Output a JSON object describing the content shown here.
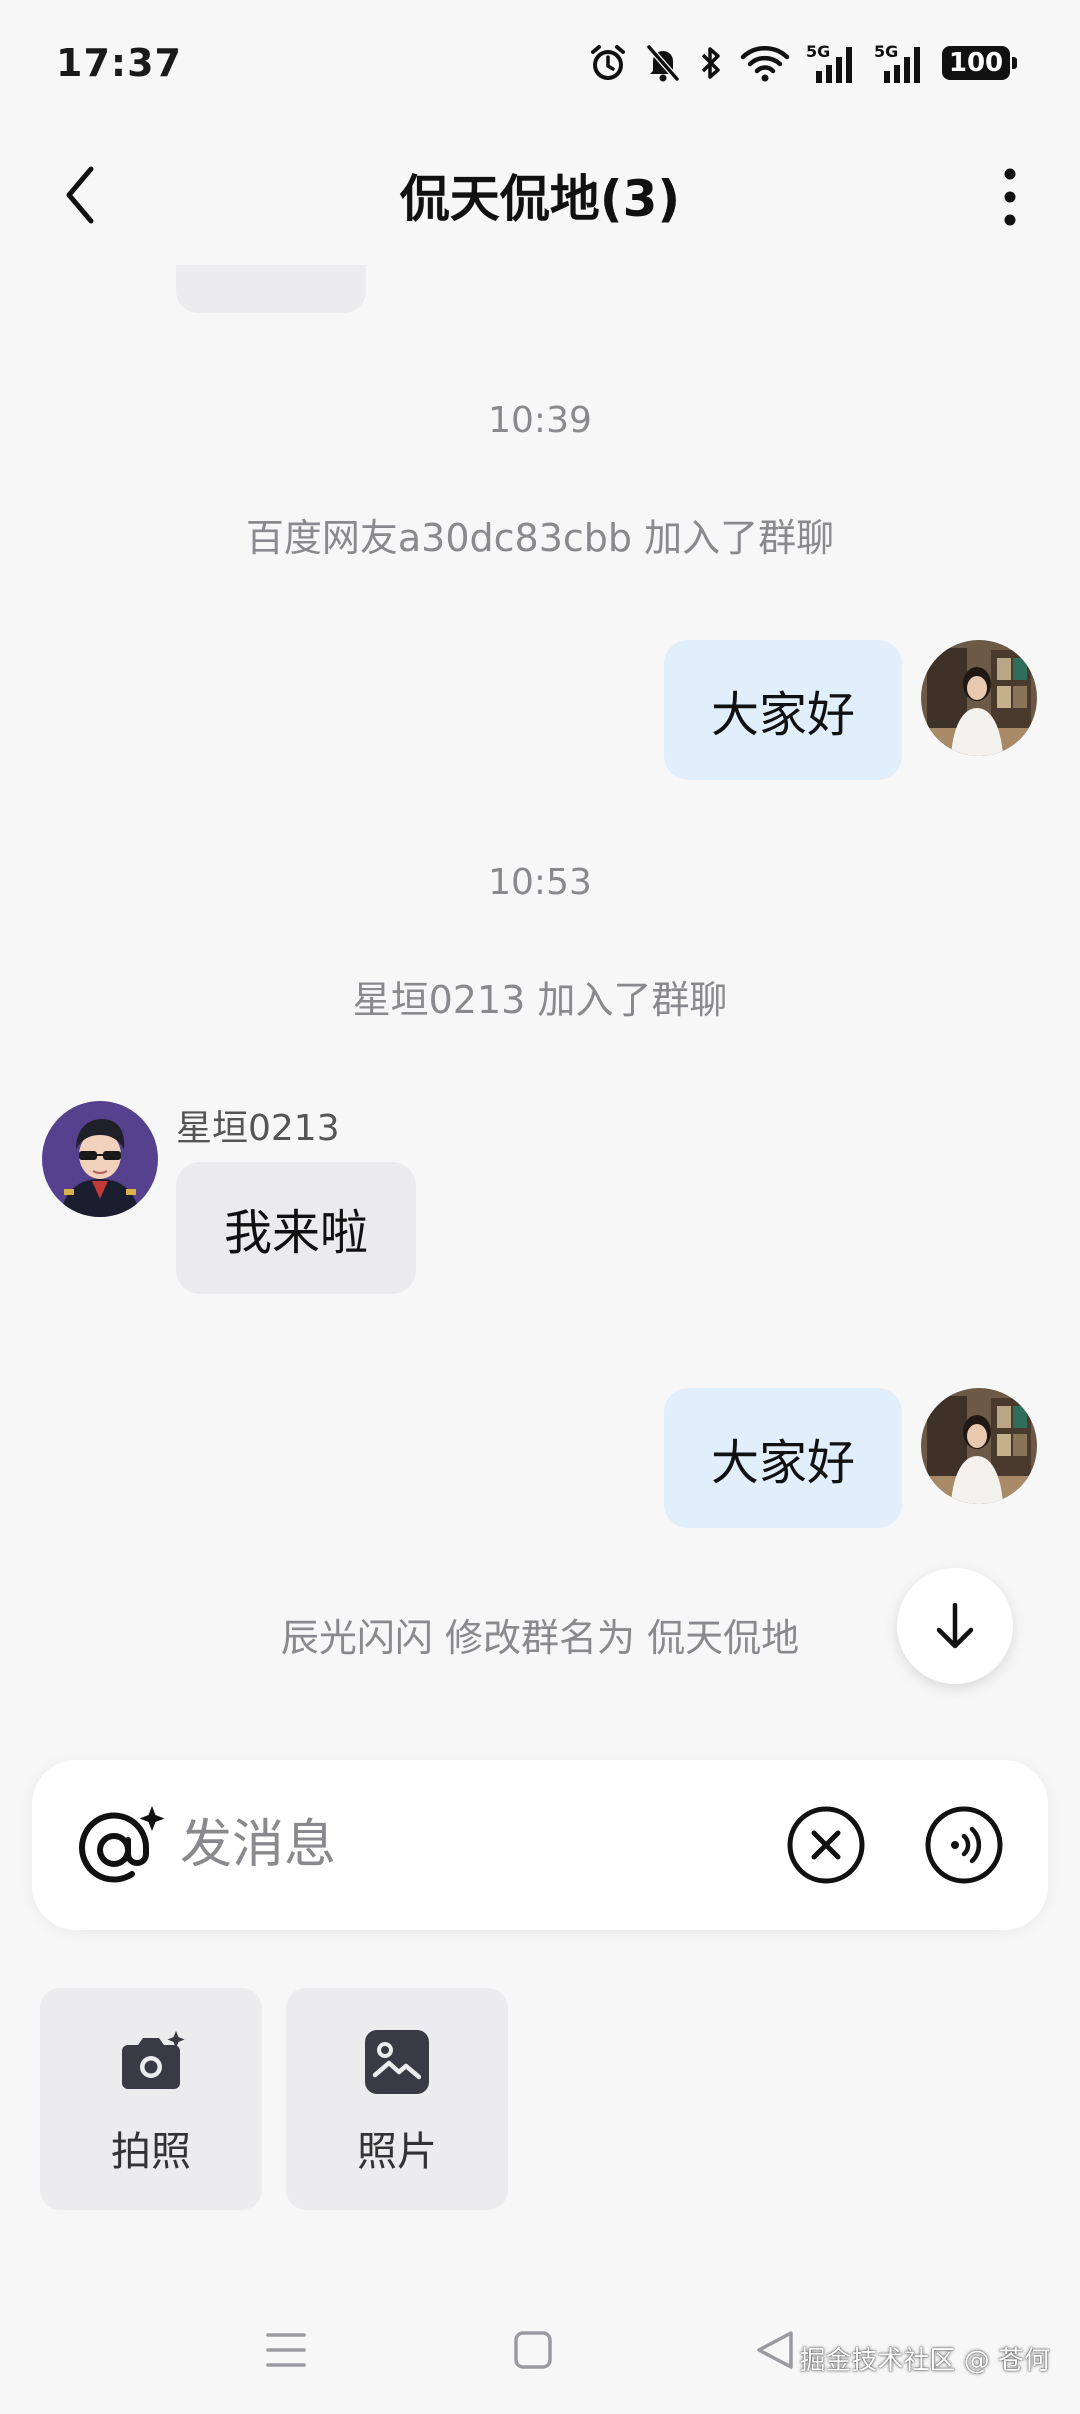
{
  "status_bar": {
    "time": "17:37",
    "battery": "100",
    "signal_1_label": "5G",
    "signal_2_label": "5G",
    "icons": [
      "alarm-icon",
      "mute-bell-icon",
      "bluetooth-icon",
      "wifi-icon",
      "signal-5g-icon",
      "signal-5g-icon",
      "battery-icon"
    ]
  },
  "header": {
    "title": "侃天侃地(3)",
    "back_icon": "chevron-left-icon",
    "more_icon": "more-vertical-icon"
  },
  "messages": {
    "time_1": "10:39",
    "system_1": "百度网友a30dc83cbb 加入了群聊",
    "outgoing_1": "大家好",
    "time_2": "10:53",
    "system_2": "星垣0213 加入了群聊",
    "incoming_sender": "星垣0213",
    "incoming_1": "我来啦",
    "outgoing_2": "大家好",
    "system_3": "辰光闪闪 修改群名为 侃天侃地"
  },
  "composer": {
    "placeholder": "发消息",
    "at_icon": "at-sparkle-icon",
    "clear_icon": "close-circle-icon",
    "voice_icon": "voice-wave-icon"
  },
  "tools": [
    {
      "label": "拍照",
      "icon": "camera-icon"
    },
    {
      "label": "照片",
      "icon": "photo-icon"
    }
  ],
  "watermark": "掘金技术社区 @ 苍何",
  "colors": {
    "background": "#f7f7f8",
    "outgoing_bubble": "#e1effd",
    "incoming_bubble": "#ebebed",
    "secondary_text": "#8a8a8e"
  }
}
